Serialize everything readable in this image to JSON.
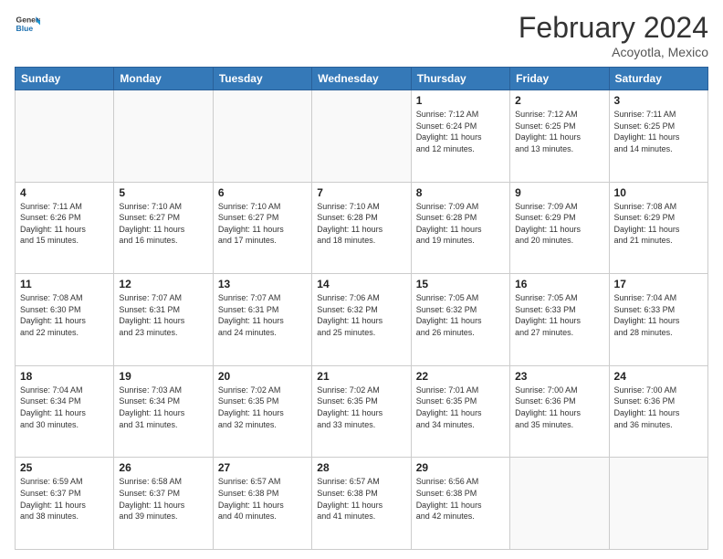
{
  "header": {
    "logo_general": "General",
    "logo_blue": "Blue",
    "month_year": "February 2024",
    "location": "Acoyotla, Mexico"
  },
  "days_of_week": [
    "Sunday",
    "Monday",
    "Tuesday",
    "Wednesday",
    "Thursday",
    "Friday",
    "Saturday"
  ],
  "weeks": [
    [
      {
        "day": "",
        "info": ""
      },
      {
        "day": "",
        "info": ""
      },
      {
        "day": "",
        "info": ""
      },
      {
        "day": "",
        "info": ""
      },
      {
        "day": "1",
        "info": "Sunrise: 7:12 AM\nSunset: 6:24 PM\nDaylight: 11 hours\nand 12 minutes."
      },
      {
        "day": "2",
        "info": "Sunrise: 7:12 AM\nSunset: 6:25 PM\nDaylight: 11 hours\nand 13 minutes."
      },
      {
        "day": "3",
        "info": "Sunrise: 7:11 AM\nSunset: 6:25 PM\nDaylight: 11 hours\nand 14 minutes."
      }
    ],
    [
      {
        "day": "4",
        "info": "Sunrise: 7:11 AM\nSunset: 6:26 PM\nDaylight: 11 hours\nand 15 minutes."
      },
      {
        "day": "5",
        "info": "Sunrise: 7:10 AM\nSunset: 6:27 PM\nDaylight: 11 hours\nand 16 minutes."
      },
      {
        "day": "6",
        "info": "Sunrise: 7:10 AM\nSunset: 6:27 PM\nDaylight: 11 hours\nand 17 minutes."
      },
      {
        "day": "7",
        "info": "Sunrise: 7:10 AM\nSunset: 6:28 PM\nDaylight: 11 hours\nand 18 minutes."
      },
      {
        "day": "8",
        "info": "Sunrise: 7:09 AM\nSunset: 6:28 PM\nDaylight: 11 hours\nand 19 minutes."
      },
      {
        "day": "9",
        "info": "Sunrise: 7:09 AM\nSunset: 6:29 PM\nDaylight: 11 hours\nand 20 minutes."
      },
      {
        "day": "10",
        "info": "Sunrise: 7:08 AM\nSunset: 6:29 PM\nDaylight: 11 hours\nand 21 minutes."
      }
    ],
    [
      {
        "day": "11",
        "info": "Sunrise: 7:08 AM\nSunset: 6:30 PM\nDaylight: 11 hours\nand 22 minutes."
      },
      {
        "day": "12",
        "info": "Sunrise: 7:07 AM\nSunset: 6:31 PM\nDaylight: 11 hours\nand 23 minutes."
      },
      {
        "day": "13",
        "info": "Sunrise: 7:07 AM\nSunset: 6:31 PM\nDaylight: 11 hours\nand 24 minutes."
      },
      {
        "day": "14",
        "info": "Sunrise: 7:06 AM\nSunset: 6:32 PM\nDaylight: 11 hours\nand 25 minutes."
      },
      {
        "day": "15",
        "info": "Sunrise: 7:05 AM\nSunset: 6:32 PM\nDaylight: 11 hours\nand 26 minutes."
      },
      {
        "day": "16",
        "info": "Sunrise: 7:05 AM\nSunset: 6:33 PM\nDaylight: 11 hours\nand 27 minutes."
      },
      {
        "day": "17",
        "info": "Sunrise: 7:04 AM\nSunset: 6:33 PM\nDaylight: 11 hours\nand 28 minutes."
      }
    ],
    [
      {
        "day": "18",
        "info": "Sunrise: 7:04 AM\nSunset: 6:34 PM\nDaylight: 11 hours\nand 30 minutes."
      },
      {
        "day": "19",
        "info": "Sunrise: 7:03 AM\nSunset: 6:34 PM\nDaylight: 11 hours\nand 31 minutes."
      },
      {
        "day": "20",
        "info": "Sunrise: 7:02 AM\nSunset: 6:35 PM\nDaylight: 11 hours\nand 32 minutes."
      },
      {
        "day": "21",
        "info": "Sunrise: 7:02 AM\nSunset: 6:35 PM\nDaylight: 11 hours\nand 33 minutes."
      },
      {
        "day": "22",
        "info": "Sunrise: 7:01 AM\nSunset: 6:35 PM\nDaylight: 11 hours\nand 34 minutes."
      },
      {
        "day": "23",
        "info": "Sunrise: 7:00 AM\nSunset: 6:36 PM\nDaylight: 11 hours\nand 35 minutes."
      },
      {
        "day": "24",
        "info": "Sunrise: 7:00 AM\nSunset: 6:36 PM\nDaylight: 11 hours\nand 36 minutes."
      }
    ],
    [
      {
        "day": "25",
        "info": "Sunrise: 6:59 AM\nSunset: 6:37 PM\nDaylight: 11 hours\nand 38 minutes."
      },
      {
        "day": "26",
        "info": "Sunrise: 6:58 AM\nSunset: 6:37 PM\nDaylight: 11 hours\nand 39 minutes."
      },
      {
        "day": "27",
        "info": "Sunrise: 6:57 AM\nSunset: 6:38 PM\nDaylight: 11 hours\nand 40 minutes."
      },
      {
        "day": "28",
        "info": "Sunrise: 6:57 AM\nSunset: 6:38 PM\nDaylight: 11 hours\nand 41 minutes."
      },
      {
        "day": "29",
        "info": "Sunrise: 6:56 AM\nSunset: 6:38 PM\nDaylight: 11 hours\nand 42 minutes."
      },
      {
        "day": "",
        "info": ""
      },
      {
        "day": "",
        "info": ""
      }
    ]
  ]
}
